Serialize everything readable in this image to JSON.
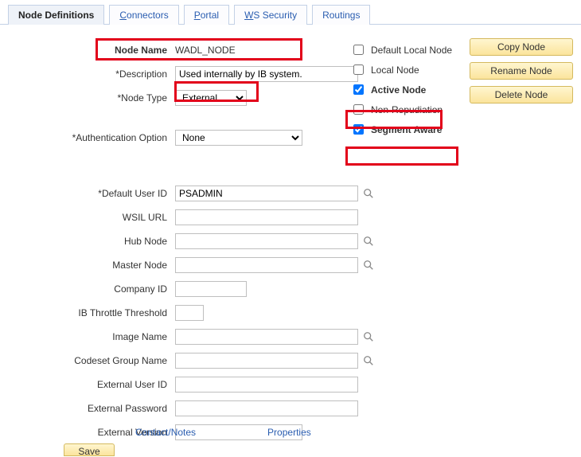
{
  "tabs": {
    "node_definitions": "Node Definitions",
    "connectors": "Connectors",
    "portal": "Portal",
    "ws_security": "WS Security",
    "routings": "Routings"
  },
  "actions": {
    "copy": "Copy Node",
    "rename": "Rename Node",
    "delete": "Delete Node"
  },
  "labels": {
    "node_name": "Node Name",
    "description": "*Description",
    "node_type": "*Node Type",
    "auth_option": "*Authentication Option",
    "default_user_id": "*Default User ID",
    "wsil_url": "WSIL URL",
    "hub_node": "Hub Node",
    "master_node": "Master Node",
    "company_id": "Company ID",
    "ib_throttle": "IB Throttle Threshold",
    "image_name": "Image Name",
    "codeset_group": "Codeset Group Name",
    "ext_user_id": "External User ID",
    "ext_password": "External Password",
    "ext_version": "External Version"
  },
  "values": {
    "node_name": "WADL_NODE",
    "description": "Used internally by IB system.",
    "node_type": "External",
    "auth_option": "None",
    "default_user_id": "PSADMIN",
    "wsil_url": "",
    "hub_node": "",
    "master_node": "",
    "company_id": "",
    "ib_throttle": "",
    "image_name": "",
    "codeset_group": "",
    "ext_user_id": "",
    "ext_password": "",
    "ext_version": ""
  },
  "checkboxes": {
    "default_local": {
      "label": "Default Local Node",
      "checked": false
    },
    "local_node": {
      "label": "Local Node",
      "checked": false
    },
    "active_node": {
      "label": "Active Node",
      "checked": true
    },
    "non_repud": {
      "label": "Non-Repudiation",
      "checked": false
    },
    "segment_aware": {
      "label": "Segment Aware",
      "checked": true
    }
  },
  "links": {
    "contact_notes": "Contact/Notes",
    "properties": "Properties"
  },
  "buttons": {
    "save": "Save"
  }
}
